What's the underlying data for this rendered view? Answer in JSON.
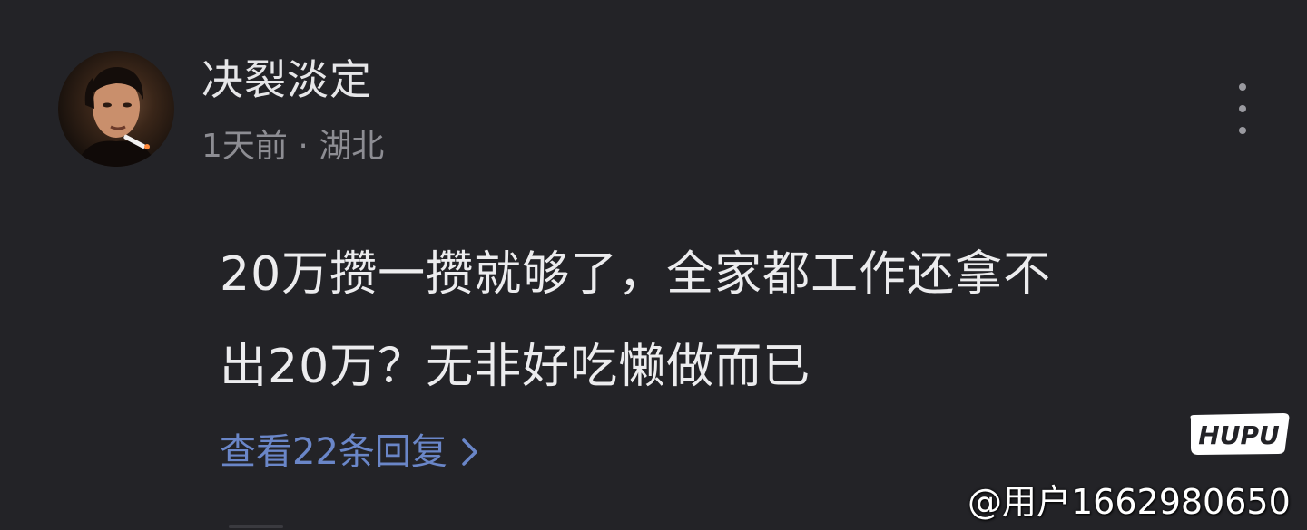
{
  "comment": {
    "username": "决裂淡定",
    "meta": "1天前 · 湖北",
    "body_line1": "20万攒一攒就够了，全家都工作还拿不",
    "body_line2": "出20万？无非好吃懒做而已",
    "view_replies": "查看22条回复",
    "avatar_icon": "user-avatar-photo",
    "more_icon": "vertical-ellipsis-icon",
    "reply_chevron_icon": "chevron-right-icon"
  },
  "watermark": {
    "logo_text": "HUPU",
    "user_tag": "@用户1662980650"
  },
  "colors": {
    "background": "#232327",
    "primary_text": "#ececee",
    "secondary_text": "#8d8d93",
    "link": "#6a86c8"
  }
}
